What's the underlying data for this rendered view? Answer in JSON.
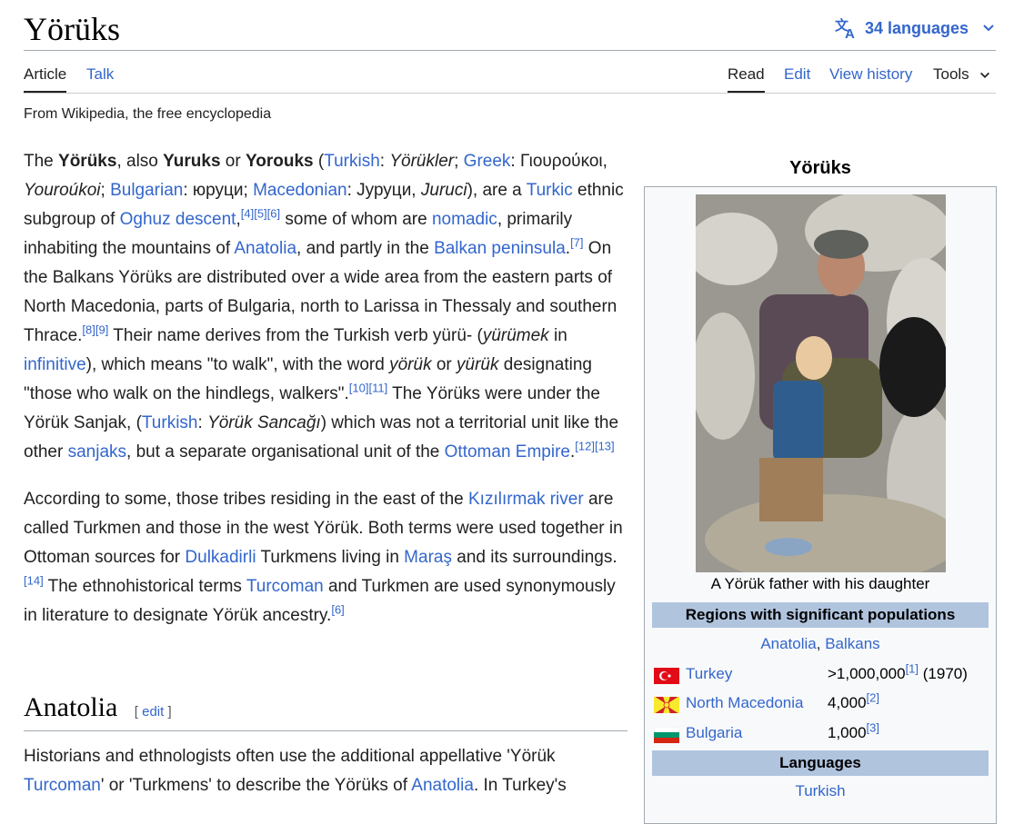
{
  "page": {
    "title": "Yörüks",
    "languages_label": "34 languages",
    "tagline": "From Wikipedia, the free encyclopedia"
  },
  "tabs": {
    "article": "Article",
    "talk": "Talk",
    "read": "Read",
    "edit": "Edit",
    "view_history": "View history",
    "tools": "Tools"
  },
  "body": {
    "p1": {
      "t1": "The ",
      "b1": "Yörüks",
      "t2": ", also ",
      "b2": "Yuruks",
      "t3": " or ",
      "b3": "Yorouks",
      "t4": " (",
      "l_turkish": "Turkish",
      "t5": ": ",
      "i_yorukler": "Yörükler",
      "t6": "; ",
      "l_greek": "Greek",
      "t7": ": Γιουρούκοι, ",
      "i_youroukoi": "Youroúkoi",
      "t8": "; ",
      "l_bulgarian": "Bulgarian",
      "t9": ": юруци; ",
      "l_macedonian": "Macedonian",
      "t10": ": Јуруци, ",
      "i_juruci": "Juruci",
      "t11": "), are a ",
      "l_turkic": "Turkic",
      "t12": " ethnic subgroup of ",
      "l_oghuz": "Oghuz descent",
      "t13": ",",
      "c4": "[4]",
      "c5": "[5]",
      "c6": "[6]",
      "t14": " some of whom are ",
      "l_nomadic": "nomadic",
      "t15": ", primarily inhabiting the mountains of ",
      "l_anatolia": "Anatolia",
      "t16": ", and partly in the ",
      "l_balkan": "Balkan peninsula",
      "t17": ".",
      "c7": "[7]",
      "t18": " On the Balkans Yörüks are distributed over a wide area from the eastern parts of North Macedonia, parts of Bulgaria, north to Larissa in Thessaly and southern Thrace.",
      "c8": "[8]",
      "c9": "[9]",
      "t19": " Their name derives from the Turkish verb yürü- (",
      "i_yurumek": "yürümek",
      "t20": " in ",
      "l_infinitive": "infinitive",
      "t21": "), which means \"to walk\", with the word ",
      "i_yoruk": "yörük",
      "t22": " or ",
      "i_yuruk": "yürük",
      "t23": " designating \"those who walk on the hindlegs, walkers\".",
      "c10": "[10]",
      "c11": "[11]",
      "t24": " The Yörüks were under the Yörük Sanjak, (",
      "l_turkish2": "Turkish",
      "t25": ": ",
      "i_sancagi": "Yörük Sancağı",
      "t26": ") which was not a territorial unit like the other ",
      "l_sanjaks": "sanjaks",
      "t27": ", but a separate organisational unit of the ",
      "l_ottoman": "Ottoman Empire",
      "t28": ".",
      "c12": "[12]",
      "c13": "[13]"
    },
    "p2": {
      "t1": "According to some, those tribes residing in the east of the ",
      "l_kizilirmak": "Kızılırmak river",
      "t2": " are called Turkmen and those in the west Yörük. Both terms were used together in Ottoman sources for ",
      "l_dulkadirli": "Dulkadirli",
      "t3": " Turkmens living in ",
      "l_maras": "Maraş",
      "t4": " and its surroundings.",
      "c14": "[14]",
      "t5": " The ethnohistorical terms ",
      "l_turcoman": "Turcoman",
      "t6": " and Turkmen are used synonymously in literature to designate Yörük ancestry.",
      "c6": "[6]"
    },
    "section": {
      "title": "Anatolia",
      "edit": "edit"
    },
    "p3": {
      "t1": "Historians and ethnologists often use the additional appellative 'Yörük ",
      "l_turcoman": "Turcoman",
      "t2": "' or 'Turkmens' to describe the Yörüks of ",
      "l_anatolia": "Anatolia",
      "t3": ". In Turkey's"
    }
  },
  "infobox": {
    "title": "Yörüks",
    "caption": "A Yörük father with his daughter",
    "regions_header": "Regions with significant populations",
    "regions_anatolia": "Anatolia",
    "regions_sep": ", ",
    "regions_balkans": "Balkans",
    "populations": [
      {
        "name": "Turkey",
        "value": ">1,000,000",
        "cite": "[1]",
        "extra": " (1970)",
        "flag": "turkey-flag"
      },
      {
        "name": "North Macedonia",
        "value": "4,000",
        "cite": "[2]",
        "extra": "",
        "flag": "north-macedonia-flag"
      },
      {
        "name": "Bulgaria",
        "value": "1,000",
        "cite": "[3]",
        "extra": "",
        "flag": "bulgaria-flag"
      }
    ],
    "languages_header": "Languages",
    "language": "Turkish"
  },
  "colors": {
    "link": "#3366cc",
    "band": "#b0c4de",
    "text": "#202122"
  }
}
